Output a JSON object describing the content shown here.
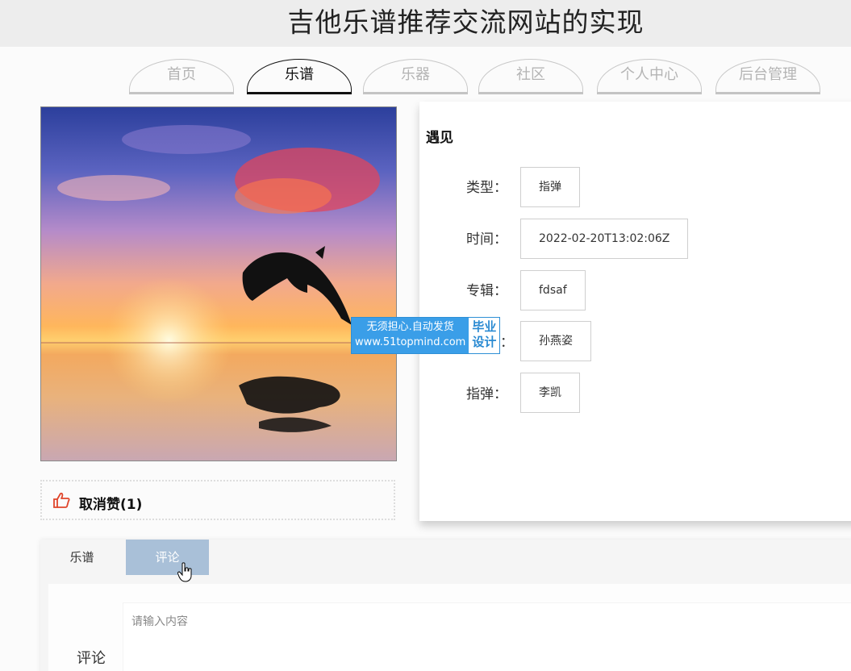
{
  "header": {
    "title": "吉他乐谱推荐交流网站的实现"
  },
  "nav": {
    "tabs": [
      {
        "label": "首页",
        "active": false
      },
      {
        "label": "乐谱",
        "active": true
      },
      {
        "label": "乐器",
        "active": false
      },
      {
        "label": "社区",
        "active": false
      },
      {
        "label": "个人中心",
        "active": false
      },
      {
        "label": "后台管理",
        "active": false
      }
    ]
  },
  "detail": {
    "title": "遇见",
    "fields": [
      {
        "label": "类型：",
        "value": "指弹"
      },
      {
        "label": "时间：",
        "value": "2022-02-20T13:02:06Z"
      },
      {
        "label": "专辑：",
        "value": "fdsaf"
      },
      {
        "label": "：",
        "value": "孙燕姿"
      },
      {
        "label": "指弹：",
        "value": "李凯"
      }
    ]
  },
  "watermark": {
    "line1": "无须担心.自动发货",
    "line2": "www.51topmind.com",
    "side1": "毕业",
    "side2": "设计"
  },
  "like": {
    "label": "取消赞(1)"
  },
  "content_tabs": [
    {
      "label": "乐谱",
      "active": false
    },
    {
      "label": "评论",
      "active": true
    }
  ],
  "comment": {
    "label": "评论",
    "placeholder": "请输入内容"
  },
  "colors": {
    "nav_active": "#111111",
    "nav_inactive": "#b4b4b4",
    "tab_active_bg": "#a9c0d8",
    "like_icon": "#e0452b"
  }
}
